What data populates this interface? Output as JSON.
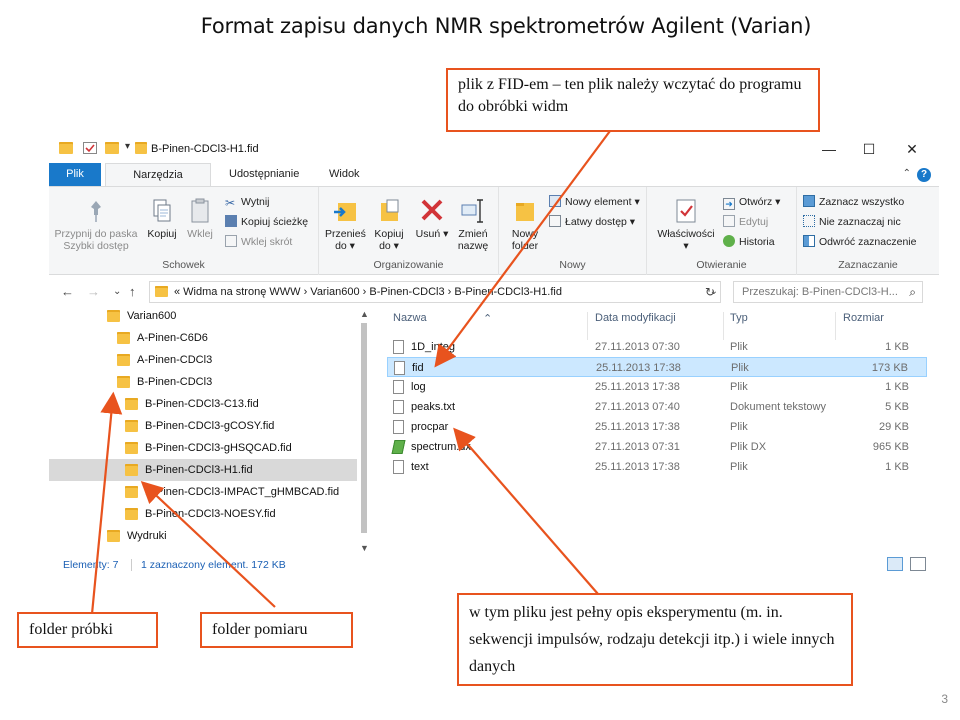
{
  "slide": {
    "title": "Format zapisu danych NMR spektrometrów Agilent (Varian)",
    "page_number": "3"
  },
  "window": {
    "title": "B-Pinen-CDCl3-H1.fid",
    "controls": {
      "minimize": "—",
      "maximize": "☐",
      "close": "✕"
    }
  },
  "ribbon_tabs": [
    "Plik",
    "Narzędzia główne",
    "Udostępnianie",
    "Widok"
  ],
  "ribbon": {
    "schowek": {
      "label": "Schowek",
      "pin": "Przypnij do paska Szybki dostęp",
      "copy": "Kopiuj",
      "paste": "Wklej",
      "cut": "Wytnij",
      "copy_path": "Kopiuj ścieżkę",
      "paste_shortcut": "Wklej skrót"
    },
    "organizowanie": {
      "label": "Organizowanie",
      "move_to": "Przenieś do ▾",
      "copy_to": "Kopiuj do ▾",
      "delete": "Usuń ▾",
      "rename": "Zmień nazwę"
    },
    "nowy": {
      "label": "Nowy",
      "new_folder": "Nowy folder",
      "new_item": "Nowy element ▾",
      "easy_access": "Łatwy dostęp ▾"
    },
    "otwieranie": {
      "label": "Otwieranie",
      "properties": "Właściwości ▾",
      "open": "Otwórz ▾",
      "edit": "Edytuj",
      "history": "Historia"
    },
    "zaznaczanie": {
      "label": "Zaznaczanie",
      "select_all": "Zaznacz wszystko",
      "select_none": "Nie zaznaczaj nic",
      "invert": "Odwróć zaznaczenie"
    }
  },
  "address": {
    "path": "«  Widma na stronę WWW  ›  Varian600  ›  B-Pinen-CDCl3  ›  B-Pinen-CDCl3-H1.fid",
    "search_placeholder": "Przeszukaj: B-Pinen-CDCl3-H..."
  },
  "tree": [
    {
      "label": "Varian600",
      "level": 0,
      "selected": false
    },
    {
      "label": "A-Pinen-C6D6",
      "level": 1,
      "selected": false
    },
    {
      "label": "A-Pinen-CDCl3",
      "level": 1,
      "selected": false
    },
    {
      "label": "B-Pinen-CDCl3",
      "level": 1,
      "selected": false
    },
    {
      "label": "B-Pinen-CDCl3-C13.fid",
      "level": 2,
      "selected": false
    },
    {
      "label": "B-Pinen-CDCl3-gCOSY.fid",
      "level": 2,
      "selected": false
    },
    {
      "label": "B-Pinen-CDCl3-gHSQCAD.fid",
      "level": 2,
      "selected": false
    },
    {
      "label": "B-Pinen-CDCl3-H1.fid",
      "level": 2,
      "selected": true
    },
    {
      "label": "B-Pinen-CDCl3-IMPACT_gHMBCAD.fid",
      "level": 2,
      "selected": false
    },
    {
      "label": "B-Pinen-CDCl3-NOESY.fid",
      "level": 2,
      "selected": false
    },
    {
      "label": "Wydruki",
      "level": 0,
      "selected": false
    }
  ],
  "columns": {
    "name": "Nazwa",
    "date": "Data modyfikacji",
    "type": "Typ",
    "size": "Rozmiar"
  },
  "files": [
    {
      "name": "1D_integ",
      "date": "27.11.2013 07:30",
      "type": "Plik",
      "size": "1 KB",
      "selected": false
    },
    {
      "name": "fid",
      "date": "25.11.2013 17:38",
      "type": "Plik",
      "size": "173 KB",
      "selected": true
    },
    {
      "name": "log",
      "date": "25.11.2013 17:38",
      "type": "Plik",
      "size": "1 KB",
      "selected": false
    },
    {
      "name": "peaks.txt",
      "date": "27.11.2013 07:40",
      "type": "Dokument tekstowy",
      "size": "5 KB",
      "selected": false
    },
    {
      "name": "procpar",
      "date": "25.11.2013 17:38",
      "type": "Plik",
      "size": "29 KB",
      "selected": false
    },
    {
      "name": "spectrum.dx",
      "date": "27.11.2013 07:31",
      "type": "Plik DX",
      "size": "965 KB",
      "selected": false
    },
    {
      "name": "text",
      "date": "25.11.2013 17:38",
      "type": "Plik",
      "size": "1 KB",
      "selected": false
    }
  ],
  "status": {
    "count": "Elementy: 7",
    "selection": "1 zaznaczony element. 172 KB"
  },
  "callouts": {
    "fid": "plik z FID-em – ten plik należy wczytać do programu do obróbki widm",
    "sample_folder": "folder próbki",
    "measurement_folder": "folder pomiaru",
    "procpar": "w tym pliku jest pełny opis eksperymentu (m. in. sekwencji impulsów, rodzaju detekcji itp.) i wiele innych danych"
  },
  "colors": {
    "accent": "#1979ca",
    "callout_border": "#e8531e",
    "folder": "#f6c244",
    "selection": "#cce8ff"
  }
}
